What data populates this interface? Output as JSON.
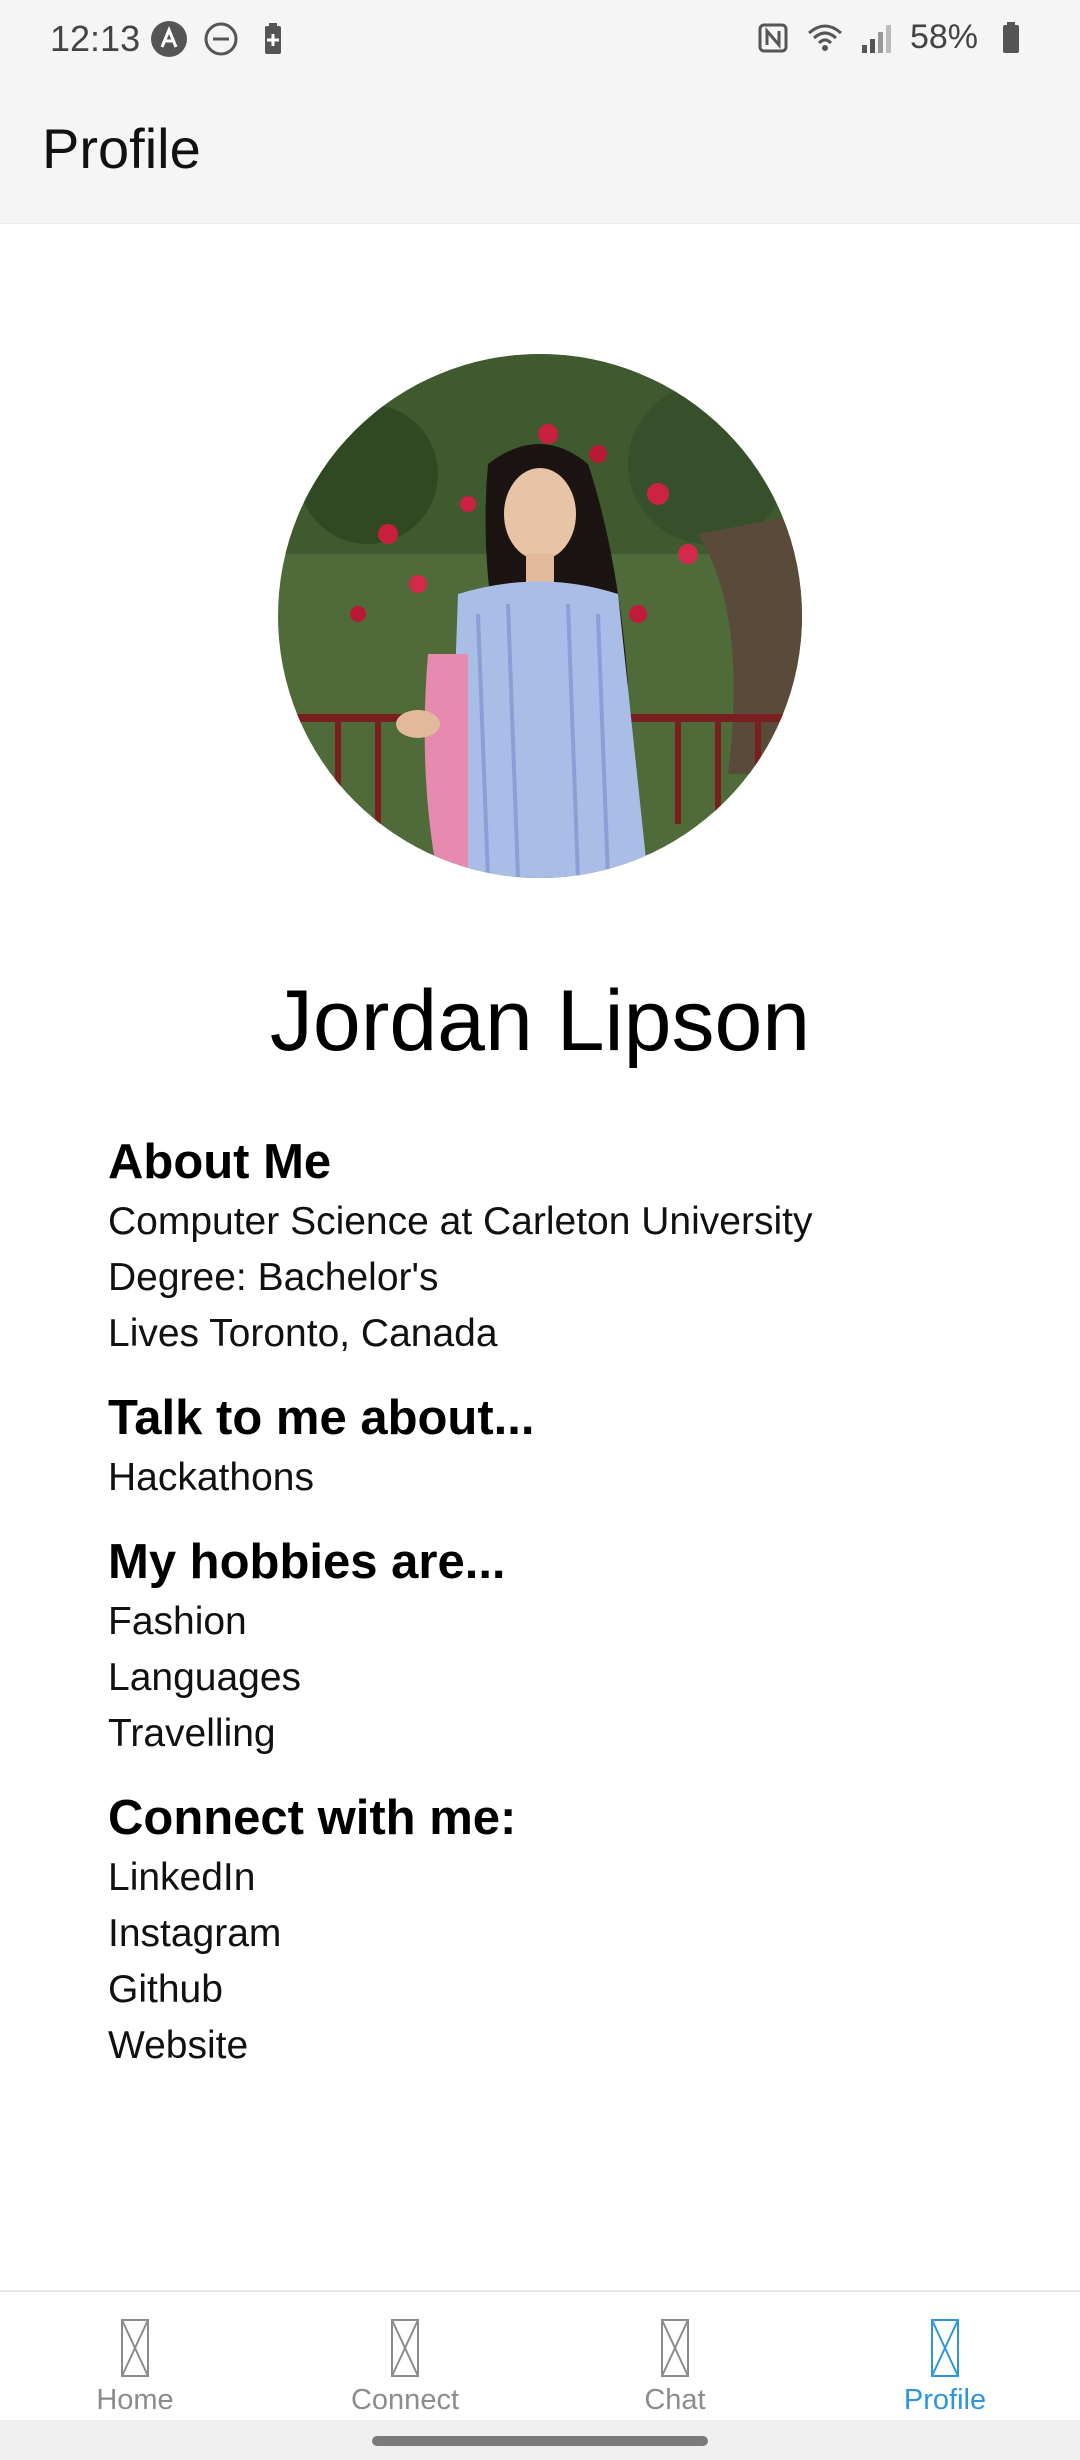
{
  "status_bar": {
    "time": "12:13",
    "battery_percent": "58%",
    "icons": [
      "app-notification-icon",
      "do-not-disturb-icon",
      "battery-saver-icon",
      "nfc-icon",
      "wifi-icon",
      "signal-icon",
      "battery-icon"
    ]
  },
  "header": {
    "title": "Profile"
  },
  "profile": {
    "name": "Jordan Lipson",
    "sections": [
      {
        "heading": "About Me",
        "lines": [
          "Computer Science at Carleton University",
          "Degree: Bachelor's",
          "Lives Toronto, Canada"
        ]
      },
      {
        "heading": "Talk to me about...",
        "lines": [
          "Hackathons"
        ]
      },
      {
        "heading": "My hobbies are...",
        "lines": [
          "Fashion",
          "Languages",
          "Travelling"
        ]
      },
      {
        "heading": "Connect with me:",
        "lines": [
          "LinkedIn",
          "Instagram",
          "Github",
          "Website"
        ]
      }
    ]
  },
  "bottom_nav": {
    "items": [
      {
        "label": "Home"
      },
      {
        "label": "Connect"
      },
      {
        "label": "Chat"
      },
      {
        "label": "Profile"
      }
    ],
    "active_index": 3,
    "active_color": "#2f95dc",
    "inactive_color": "#8c8c8c"
  }
}
